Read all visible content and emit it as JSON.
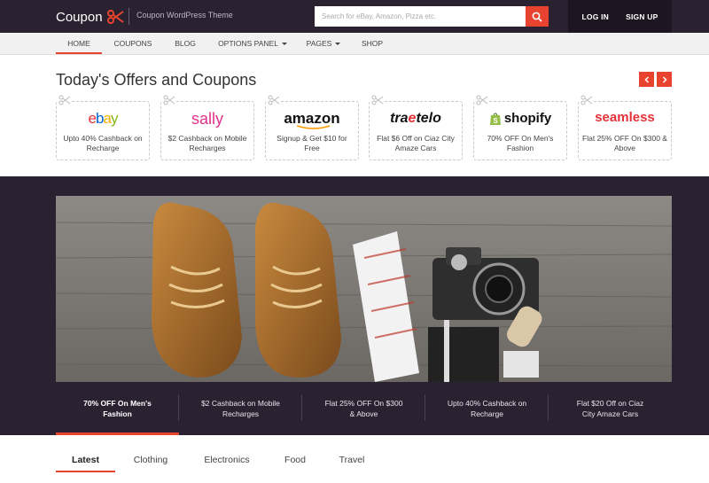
{
  "header": {
    "logo_text": "Coupon",
    "tagline": "Coupon WordPress Theme",
    "search_placeholder": "Search for eBay, Amazon, Pizza etc.",
    "login_label": "LOG IN",
    "signup_label": "SIGN UP"
  },
  "nav": {
    "items": [
      {
        "label": "HOME",
        "active": true
      },
      {
        "label": "COUPONS"
      },
      {
        "label": "BLOG"
      },
      {
        "label": "OPTIONS PANEL",
        "dropdown": true
      },
      {
        "label": "PAGES",
        "dropdown": true
      },
      {
        "label": "SHOP"
      }
    ]
  },
  "offers": {
    "title": "Today's Offers and Coupons",
    "cards": [
      {
        "brand": "ebay",
        "text": "Upto 40% Cashback on Recharge"
      },
      {
        "brand": "sally",
        "text": "$2 Cashback on Mobile Recharges"
      },
      {
        "brand": "amazon",
        "text": "Signup & Get $10 for Free"
      },
      {
        "brand": "travelo",
        "text": "Flat $6 Off on Ciaz City Amaze Cars"
      },
      {
        "brand": "shopify",
        "text": "70% OFF On Men's Fashion"
      },
      {
        "brand": "seamless",
        "text": "Flat 25% OFF On $300 & Above"
      }
    ]
  },
  "slider": {
    "tabs": [
      {
        "label": "70% OFF On Men's Fashion",
        "active": true
      },
      {
        "label": "$2 Cashback on Mobile Recharges"
      },
      {
        "label": "Flat 25% OFF On $300 & Above"
      },
      {
        "label": "Upto 40% Cashback on Recharge"
      },
      {
        "label": "Flat $20 Off on Ciaz City Amaze Cars"
      }
    ]
  },
  "category_tabs": [
    {
      "label": "Latest",
      "active": true
    },
    {
      "label": "Clothing"
    },
    {
      "label": "Electronics"
    },
    {
      "label": "Food"
    },
    {
      "label": "Travel"
    }
  ],
  "colors": {
    "accent": "#e8432e",
    "dark": "#2b2231"
  }
}
